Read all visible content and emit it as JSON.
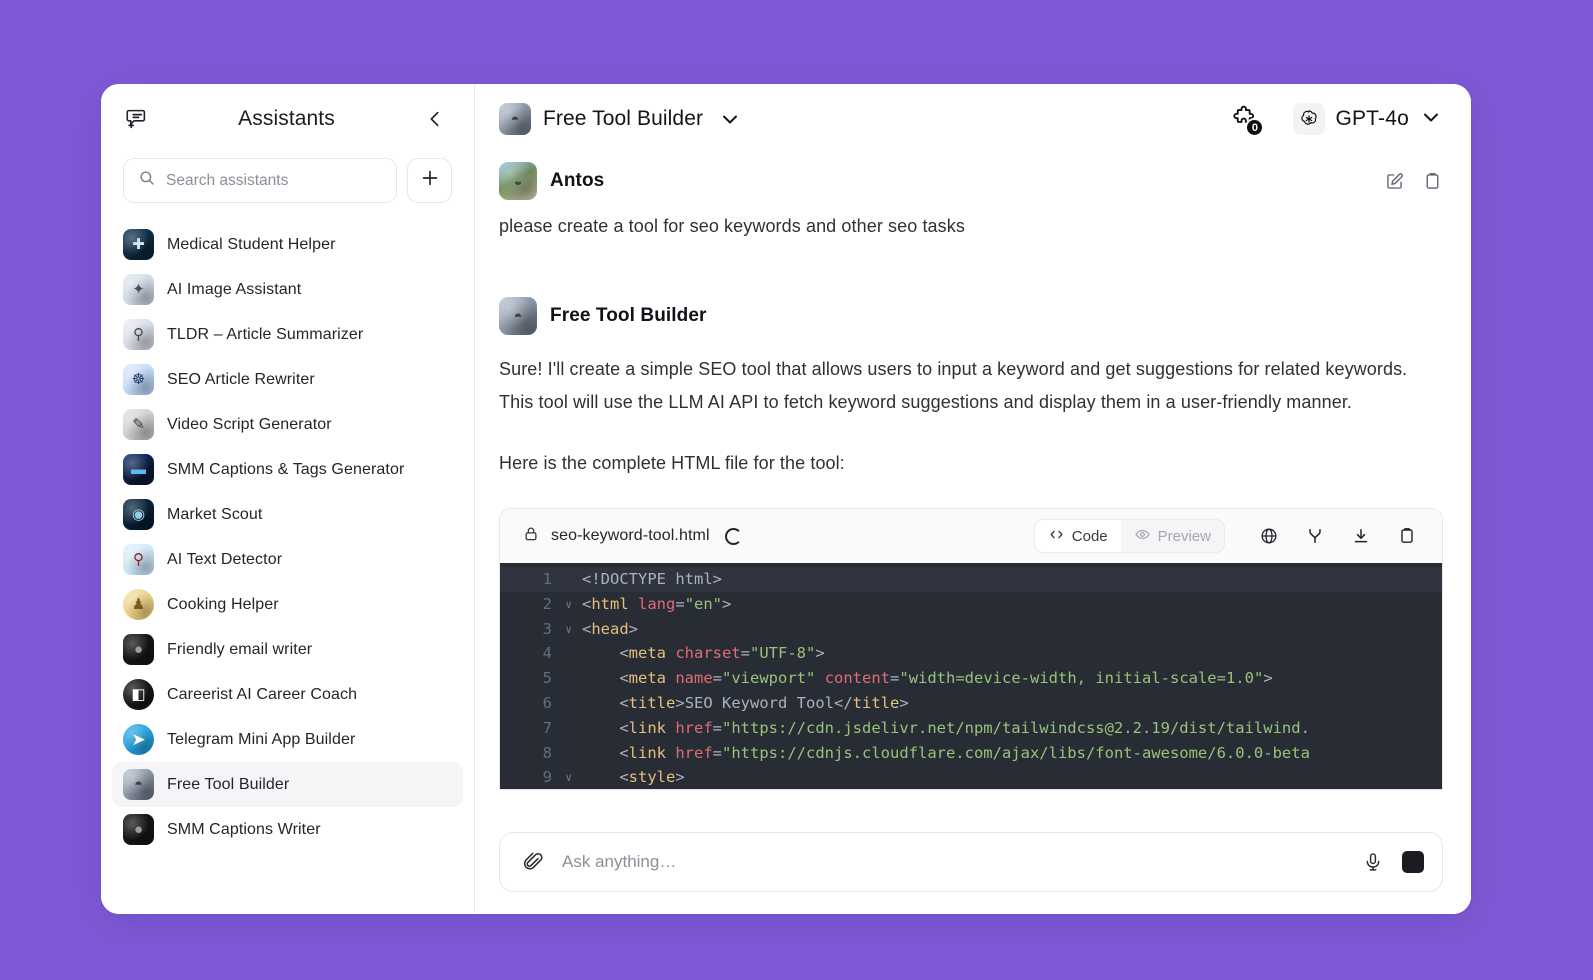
{
  "theme": {
    "page_background": "#7f5ad8",
    "window_background": "#ffffff",
    "active_item_background": "#f5f5f7",
    "code_background": "#282c34",
    "code_tag_color": "#e5c07b",
    "code_attr_color": "#e06c75",
    "code_string_color": "#98c379"
  },
  "sidebar": {
    "title": "Assistants",
    "new_chat_icon": "new-chat-icon",
    "collapse_icon": "chevron-left-icon",
    "search": {
      "placeholder": "Search assistants",
      "value": "",
      "icon": "search-icon"
    },
    "add_button_icon": "plus-icon",
    "items": [
      {
        "label": "Medical Student Helper",
        "avatar": "av-medical",
        "glyph": "✚",
        "active": false
      },
      {
        "label": "AI Image Assistant",
        "avatar": "av-image",
        "glyph": "✦",
        "active": false
      },
      {
        "label": "TLDR – Article Summarizer",
        "avatar": "av-tldr",
        "glyph": "⚲",
        "active": false
      },
      {
        "label": "SEO Article Rewriter",
        "avatar": "av-seo",
        "glyph": "☸",
        "active": false
      },
      {
        "label": "Video Script Generator",
        "avatar": "av-video",
        "glyph": "✎",
        "active": false
      },
      {
        "label": "SMM Captions & Tags Generator",
        "avatar": "av-smm",
        "glyph": "▬",
        "active": false
      },
      {
        "label": "Market Scout",
        "avatar": "av-market",
        "glyph": "◉",
        "active": false
      },
      {
        "label": "AI Text Detector",
        "avatar": "av-detector",
        "glyph": "⚲",
        "active": false
      },
      {
        "label": "Cooking Helper",
        "avatar": "av-cooking",
        "glyph": "♟",
        "active": false
      },
      {
        "label": "Friendly email writer",
        "avatar": "av-email",
        "glyph": "●",
        "active": false
      },
      {
        "label": "Careerist AI Career Coach",
        "avatar": "av-career",
        "glyph": "◧",
        "active": false
      },
      {
        "label": "Telegram Mini App Builder",
        "avatar": "av-telegram",
        "glyph": "➤",
        "active": false
      },
      {
        "label": "Free Tool Builder",
        "avatar": "av-tool",
        "glyph": "◓",
        "active": true
      },
      {
        "label": "SMM Captions Writer",
        "avatar": "av-smmw",
        "glyph": "●",
        "active": false
      }
    ]
  },
  "header": {
    "assistant_name": "Free Tool Builder",
    "assistant_avatar": "av-tool",
    "assistant_glyph": "◓",
    "dropdown_icon": "chevron-down-icon",
    "plugins": {
      "icon": "puzzle-piece-icon",
      "badge_count": "0"
    },
    "model": {
      "logo_icon": "openai-logo-icon",
      "name": "GPT-4o",
      "dropdown_icon": "chevron-down-icon"
    }
  },
  "conversation": {
    "user_message": {
      "author": "Antos",
      "avatar": "av-user",
      "glyph": "◒",
      "text": "please create a tool for seo keywords and other seo tasks",
      "actions": [
        {
          "name": "edit-message-icon"
        },
        {
          "name": "copy-message-icon"
        }
      ]
    },
    "assistant_message": {
      "author": "Free Tool Builder",
      "avatar": "av-tool",
      "glyph": "◓",
      "paragraph_1": "Sure! I'll create a simple SEO tool that allows users to input a keyword and get suggestions for related keywords. This tool will use the LLM AI API to fetch keyword suggestions and display them in a user-friendly manner.",
      "paragraph_2": "Here is the complete HTML file for the tool:"
    }
  },
  "artifact": {
    "lock_icon": "lock-icon",
    "filename": "seo-keyword-tool.html",
    "status_icon": "loading-spinner-icon",
    "tabs": [
      {
        "label": "Code",
        "icon": "code-brackets-icon",
        "selected": true
      },
      {
        "label": "Preview",
        "icon": "eye-icon",
        "selected": false
      }
    ],
    "tools": [
      {
        "name": "globe-icon"
      },
      {
        "name": "branch-icon"
      },
      {
        "name": "download-icon"
      },
      {
        "name": "copy-icon"
      }
    ],
    "code": {
      "language": "html",
      "lines": [
        {
          "number": "1",
          "fold": false,
          "highlight": true,
          "tokens": [
            {
              "t": "punc",
              "v": "<!DOCTYPE html>"
            }
          ]
        },
        {
          "number": "2",
          "fold": true,
          "highlight": false,
          "tokens": [
            {
              "t": "punc",
              "v": "<"
            },
            {
              "t": "tag",
              "v": "html"
            },
            {
              "t": "punc",
              "v": " "
            },
            {
              "t": "attr",
              "v": "lang"
            },
            {
              "t": "punc",
              "v": "="
            },
            {
              "t": "str",
              "v": "\"en\""
            },
            {
              "t": "punc",
              "v": ">"
            }
          ]
        },
        {
          "number": "3",
          "fold": true,
          "highlight": false,
          "tokens": [
            {
              "t": "punc",
              "v": "<"
            },
            {
              "t": "tag",
              "v": "head"
            },
            {
              "t": "punc",
              "v": ">"
            }
          ]
        },
        {
          "number": "4",
          "fold": false,
          "highlight": false,
          "tokens": [
            {
              "t": "punc",
              "v": "    <"
            },
            {
              "t": "tag",
              "v": "meta"
            },
            {
              "t": "punc",
              "v": " "
            },
            {
              "t": "attr",
              "v": "charset"
            },
            {
              "t": "punc",
              "v": "="
            },
            {
              "t": "str",
              "v": "\"UTF-8\""
            },
            {
              "t": "punc",
              "v": ">"
            }
          ]
        },
        {
          "number": "5",
          "fold": false,
          "highlight": false,
          "tokens": [
            {
              "t": "punc",
              "v": "    <"
            },
            {
              "t": "tag",
              "v": "meta"
            },
            {
              "t": "punc",
              "v": " "
            },
            {
              "t": "attr",
              "v": "name"
            },
            {
              "t": "punc",
              "v": "="
            },
            {
              "t": "str",
              "v": "\"viewport\""
            },
            {
              "t": "punc",
              "v": " "
            },
            {
              "t": "attr",
              "v": "content"
            },
            {
              "t": "punc",
              "v": "="
            },
            {
              "t": "str",
              "v": "\"width=device-width, initial-scale=1.0\""
            },
            {
              "t": "punc",
              "v": ">"
            }
          ]
        },
        {
          "number": "6",
          "fold": false,
          "highlight": false,
          "tokens": [
            {
              "t": "punc",
              "v": "    <"
            },
            {
              "t": "tag",
              "v": "title"
            },
            {
              "t": "punc",
              "v": ">"
            },
            {
              "t": "txt",
              "v": "SEO Keyword Tool"
            },
            {
              "t": "punc",
              "v": "</"
            },
            {
              "t": "tag",
              "v": "title"
            },
            {
              "t": "punc",
              "v": ">"
            }
          ]
        },
        {
          "number": "7",
          "fold": false,
          "highlight": false,
          "tokens": [
            {
              "t": "punc",
              "v": "    <"
            },
            {
              "t": "tag",
              "v": "link"
            },
            {
              "t": "punc",
              "v": " "
            },
            {
              "t": "attr",
              "v": "href"
            },
            {
              "t": "punc",
              "v": "="
            },
            {
              "t": "str",
              "v": "\"https://cdn.jsdelivr.net/npm/tailwindcss@2.2.19/dist/tailwind."
            }
          ]
        },
        {
          "number": "8",
          "fold": false,
          "highlight": false,
          "tokens": [
            {
              "t": "punc",
              "v": "    <"
            },
            {
              "t": "tag",
              "v": "link"
            },
            {
              "t": "punc",
              "v": " "
            },
            {
              "t": "attr",
              "v": "href"
            },
            {
              "t": "punc",
              "v": "="
            },
            {
              "t": "str",
              "v": "\"https://cdnjs.cloudflare.com/ajax/libs/font-awesome/6.0.0-beta"
            }
          ]
        },
        {
          "number": "9",
          "fold": true,
          "highlight": false,
          "tokens": [
            {
              "t": "punc",
              "v": "    <"
            },
            {
              "t": "tag",
              "v": "style"
            },
            {
              "t": "punc",
              "v": ">"
            }
          ]
        }
      ]
    }
  },
  "composer": {
    "attach_icon": "paperclip-icon",
    "placeholder": "Ask anything…",
    "value": "",
    "mic_icon": "microphone-icon",
    "send_icon": "stop-square-icon"
  }
}
